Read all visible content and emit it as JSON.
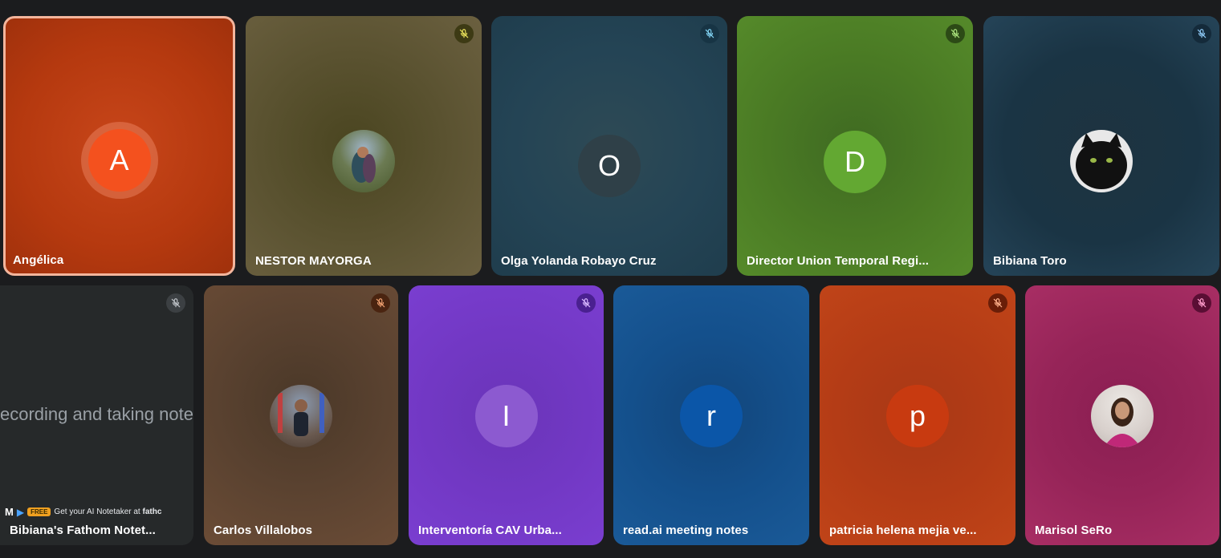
{
  "participants": [
    {
      "name": "Angélica",
      "initial": "A",
      "speaking": true,
      "muted": false
    },
    {
      "name": "NESTOR MAYORGA",
      "initial": "",
      "photo": true,
      "muted": true
    },
    {
      "name": "Olga Yolanda Robayo Cruz",
      "initial": "O",
      "muted": true
    },
    {
      "name": "Director Union Temporal Regi...",
      "initial": "D",
      "muted": true
    },
    {
      "name": "Bibiana Toro",
      "initial": "",
      "photo": true,
      "muted": true
    },
    {
      "name": "Bibiana's Fathom Notet...",
      "initial": "",
      "muted": true
    },
    {
      "name": "Carlos Villalobos",
      "initial": "",
      "photo": true,
      "muted": true
    },
    {
      "name": "Interventoría CAV Urba...",
      "initial": "I",
      "muted": true
    },
    {
      "name": "read.ai meeting notes",
      "initial": "r",
      "muted": false
    },
    {
      "name": "patricia helena mejia ve...",
      "initial": "p",
      "muted": true
    },
    {
      "name": "Marisol SeRo",
      "initial": "",
      "photo": true,
      "muted": true
    }
  ],
  "fathom": {
    "screen_text": "ecording and taking notes",
    "brand_letter": "M",
    "badge": "FREE",
    "cta_prefix": "Get your AI Notetaker at",
    "cta_link": "fathc"
  },
  "colors": {
    "active_border": "#f3b59c",
    "background": "#1b1c1e"
  },
  "icons": {
    "mute": "mic-off-icon"
  }
}
